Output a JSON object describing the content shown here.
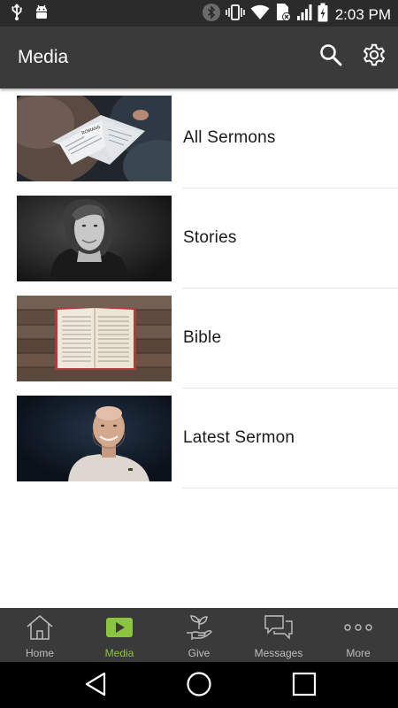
{
  "status_bar": {
    "time": "2:03 PM",
    "left_icons": [
      "usb-icon",
      "android-debug-icon"
    ],
    "right_icons": [
      "bluetooth-icon",
      "vibrate-icon",
      "wifi-icon",
      "no-sim-icon",
      "signal-icon",
      "battery-icon"
    ]
  },
  "app_bar": {
    "title": "Media",
    "actions": [
      "search-icon",
      "gear-icon"
    ]
  },
  "media_items": [
    {
      "label": "All Sermons",
      "thumbnail": "open-bible-photo"
    },
    {
      "label": "Stories",
      "thumbnail": "woman-portrait-photo"
    },
    {
      "label": "Bible",
      "thumbnail": "bible-on-wood-photo"
    },
    {
      "label": "Latest Sermon",
      "thumbnail": "speaker-photo"
    }
  ],
  "bottom_nav": {
    "tabs": [
      {
        "label": "Home",
        "icon": "home-icon",
        "active": false
      },
      {
        "label": "Media",
        "icon": "play-icon",
        "active": true
      },
      {
        "label": "Give",
        "icon": "plant-hand-icon",
        "active": false
      },
      {
        "label": "Messages",
        "icon": "chat-bubbles-icon",
        "active": false
      },
      {
        "label": "More",
        "icon": "more-dots-icon",
        "active": false
      }
    ]
  },
  "system_nav": {
    "buttons": [
      "back-icon",
      "home-circle-icon",
      "recents-icon"
    ]
  },
  "colors": {
    "status_bar_bg": "#2b2b2b",
    "app_bar_bg": "#3a3a3a",
    "accent": "#8bc53f",
    "inactive_tab": "#bdbdbd",
    "system_nav_bg": "#000000"
  }
}
